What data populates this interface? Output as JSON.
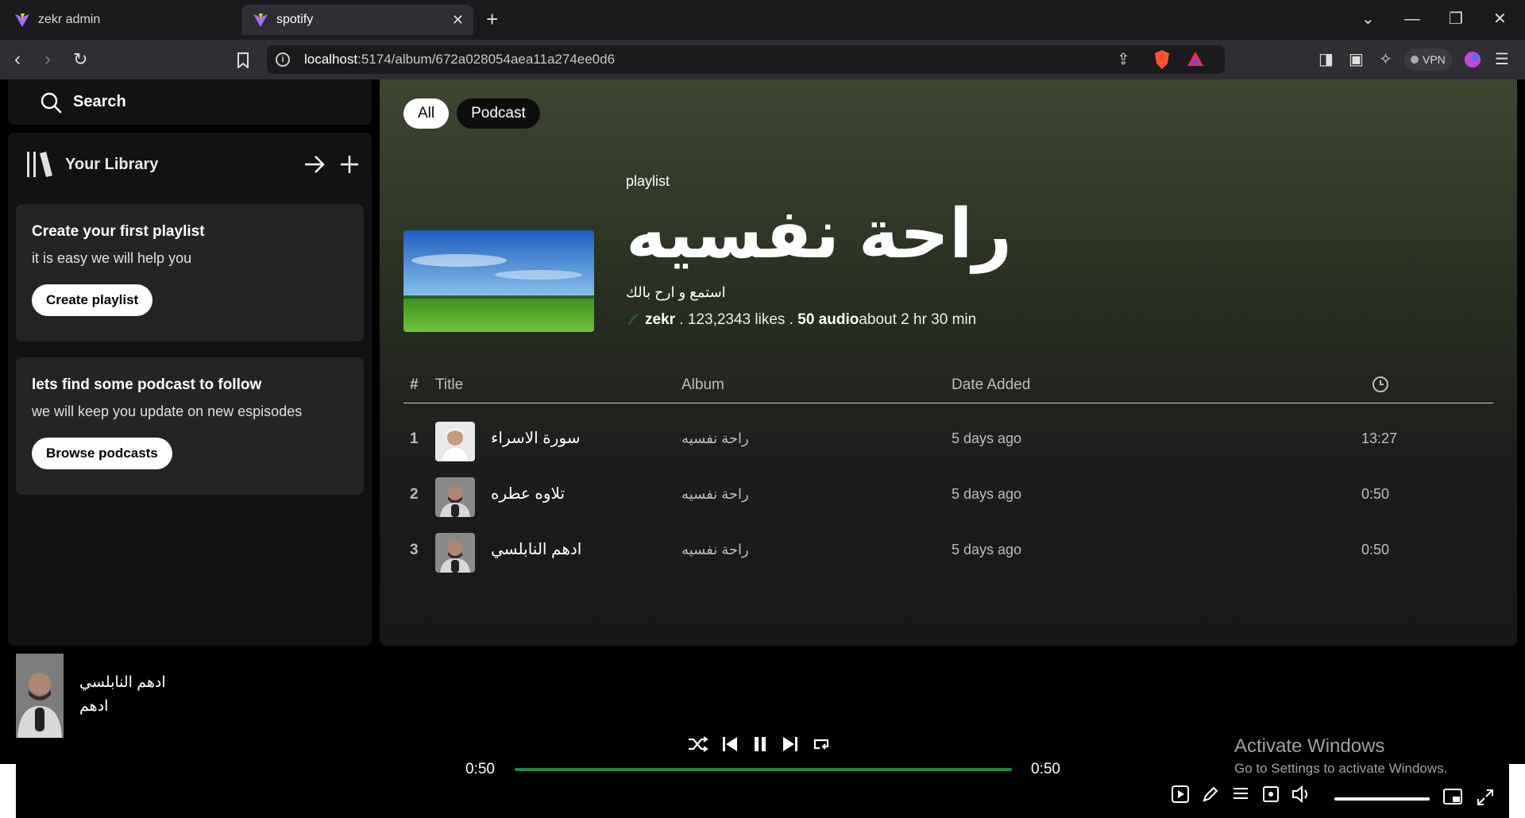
{
  "browser": {
    "tabs": [
      {
        "title": "zekr admin",
        "active": false
      },
      {
        "title": "spotify",
        "active": true
      }
    ],
    "url_host": "localhost",
    "url_path": ":5174/album/672a028054aea11a274ee0d6",
    "vpn_label": "VPN"
  },
  "sidebar": {
    "search_label": "Search",
    "library_title": "Your Library",
    "cards": [
      {
        "heading": "Create your first playlist",
        "text": "it is easy we will help you",
        "button": "Create playlist"
      },
      {
        "heading": "lets find some podcast to follow",
        "text": "we will keep you update on new espisodes",
        "button": "Browse podcasts"
      }
    ]
  },
  "main": {
    "filters": [
      "All",
      "Podcast"
    ],
    "playlist": {
      "type": "playlist",
      "title": "راحة نفسيه",
      "description": "استمع و ارح بالك",
      "owner": "zekr",
      "likes": " . 123,2343 likes . ",
      "audio_count": "50 audio",
      "duration": "about 2 hr 30 min"
    },
    "table": {
      "headers": {
        "num": "#",
        "title": "Title",
        "album": "Album",
        "date": "Date Added"
      },
      "rows": [
        {
          "num": "1",
          "title": "سورة الاسراء",
          "album": "راحة نفسيه",
          "date": "5 days ago",
          "duration": "13:27"
        },
        {
          "num": "2",
          "title": "تلاوه عطره",
          "album": "راحة نفسيه",
          "date": "5 days ago",
          "duration": "0:50"
        },
        {
          "num": "3",
          "title": "ادهم النابلسي",
          "album": "راحة نفسيه",
          "date": "5 days ago",
          "duration": "0:50"
        }
      ]
    }
  },
  "player": {
    "title": "ادهم النابلسي",
    "artist": "ادهم",
    "elapsed": "0:50",
    "total": "0:50",
    "progress": 1.0
  },
  "watermark": {
    "line1": "Activate Windows",
    "line2": "Go to Settings to activate Windows."
  },
  "colors": {
    "accent": "#1f8a46",
    "panel": "#121212",
    "card": "#242424"
  }
}
